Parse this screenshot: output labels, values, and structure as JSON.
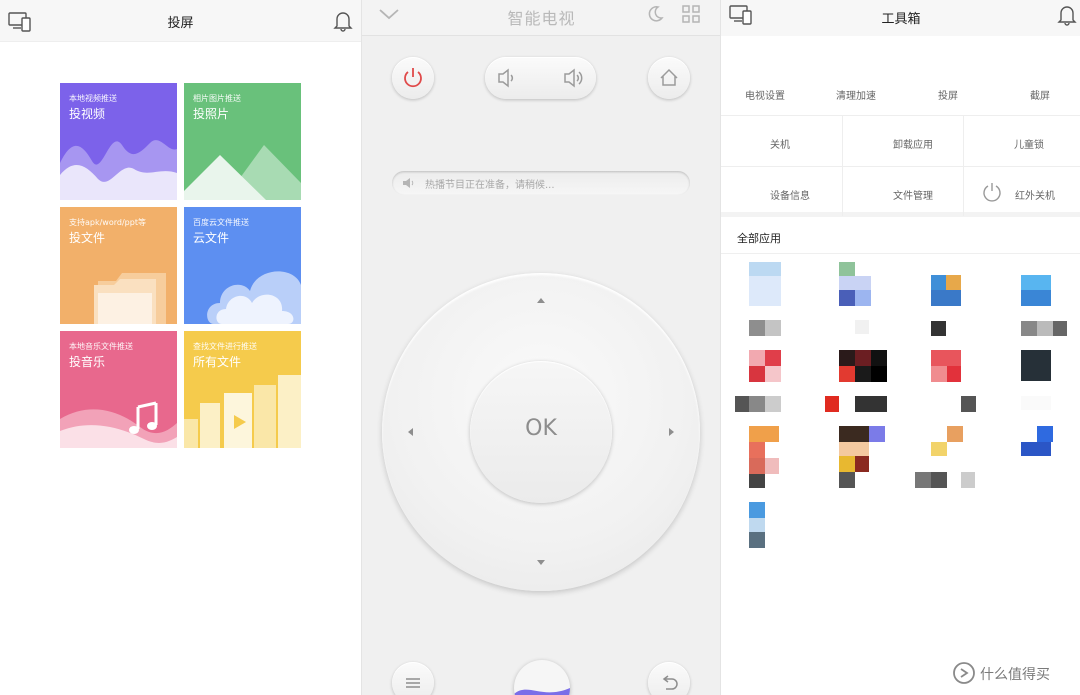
{
  "cast_screen": {
    "title": "投屏",
    "tiles": [
      {
        "sub": "本地视频推送",
        "main": "投视频",
        "color": "#7c62ea"
      },
      {
        "sub": "相片图片推送",
        "main": "投照片",
        "color": "#69c17b"
      },
      {
        "sub": "支持apk/word/ppt等",
        "main": "投文件",
        "color": "#f2b06a"
      },
      {
        "sub": "百度云文件推送",
        "main": "云文件",
        "color": "#5d8ff1"
      },
      {
        "sub": "本地音乐文件推送",
        "main": "投音乐",
        "color": "#e8688d"
      },
      {
        "sub": "查找文件进行推送",
        "main": "所有文件",
        "color": "#f5cb4c"
      }
    ]
  },
  "remote": {
    "title": "智能电视",
    "ok_label": "OK",
    "ticker": "热播节目正在准备，请稍候...",
    "accent": "#e04a4a"
  },
  "toolbox": {
    "title": "工具箱",
    "row1": [
      "电视设置",
      "清理加速",
      "投屏",
      "截屏"
    ],
    "grid": [
      [
        "关机",
        "卸载应用",
        "儿童锁"
      ],
      [
        "设备信息",
        "文件管理",
        "红外关机"
      ]
    ],
    "section_title": "全部应用"
  },
  "watermark": "什么值得买"
}
